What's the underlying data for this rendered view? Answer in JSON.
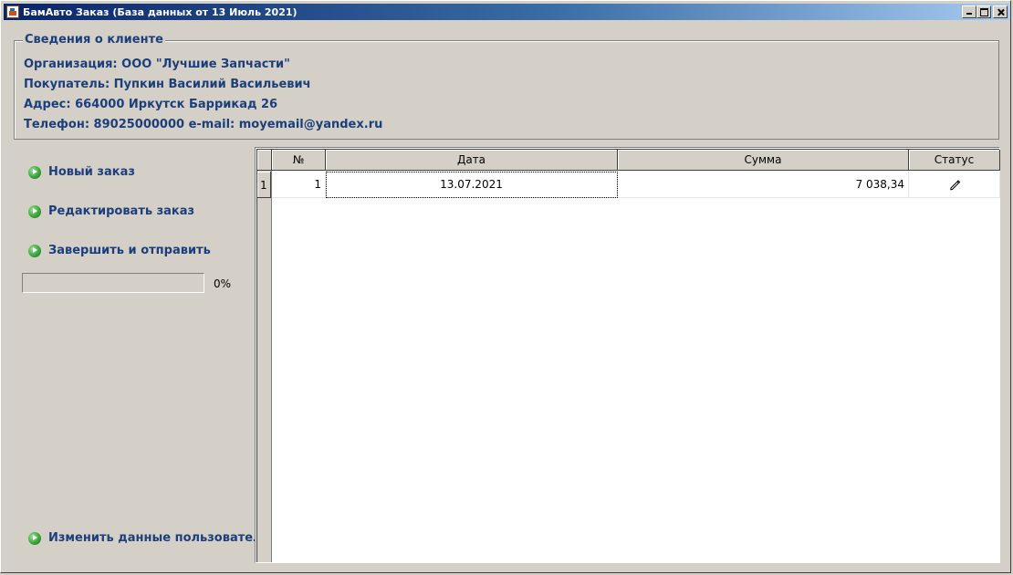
{
  "window": {
    "title": "БамАвто Заказ (База данных от 13 Июль 2021)"
  },
  "client": {
    "legend": "Сведения о клиенте",
    "organization": "Организация: ООО \"Лучшие Запчасти\"",
    "buyer": "Покупатель: Пупкин Василий Васильевич",
    "address": "Адрес: 664000 Иркутск Баррикад 26",
    "contacts": "Телефон: 89025000000 e-mail: moyemail@yandex.ru"
  },
  "actions": {
    "new_order": "Новый заказ",
    "edit_order": "Редактировать заказ",
    "finish_send": "Завершить и отправить",
    "change_user": "Изменить данные пользователя",
    "icon": "go-arrow-icon"
  },
  "progress": {
    "value_percent": 0,
    "label": "0%"
  },
  "grid": {
    "headers": {
      "number": "№",
      "date": "Дата",
      "sum": "Сумма",
      "status": "Статус"
    },
    "rows": [
      {
        "indicator": "1",
        "number": "1",
        "date": "13.07.2021",
        "sum": "7 038,34",
        "status_icon": "pencil-icon"
      }
    ]
  },
  "colors": {
    "accent_text": "#1c3f7c",
    "window_bg": "#d4d0c8",
    "title_start": "#0a246a",
    "title_end": "#a6caf0"
  }
}
